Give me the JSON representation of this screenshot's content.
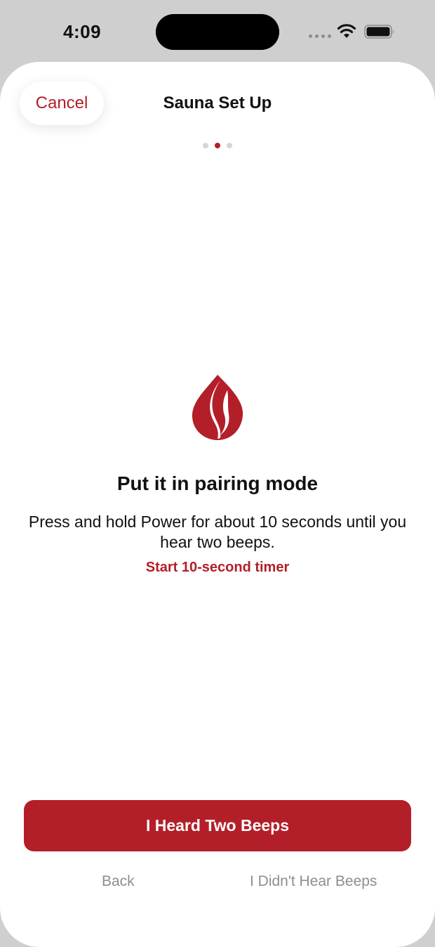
{
  "status_bar": {
    "time": "4:09",
    "icons": [
      "signal-dots-icon",
      "wifi-icon",
      "battery-icon"
    ]
  },
  "sheet": {
    "cancel_label": "Cancel",
    "title": "Sauna Set Up",
    "page_dots": {
      "total": 3,
      "active": 2
    },
    "icon": "flame-icon",
    "heading": "Put it in pairing mode",
    "description": "Press and hold Power for about 10 seconds until you hear two beeps.",
    "timer_link": "Start 10-second timer",
    "primary_button": "I Heard Two Beeps",
    "back_label": "Back",
    "no_beeps_label": "I Didn't Hear Beeps"
  },
  "colors": {
    "accent": "#b31f28",
    "secondary_text": "#8e8e93",
    "backdrop": "#cfcfcf"
  }
}
